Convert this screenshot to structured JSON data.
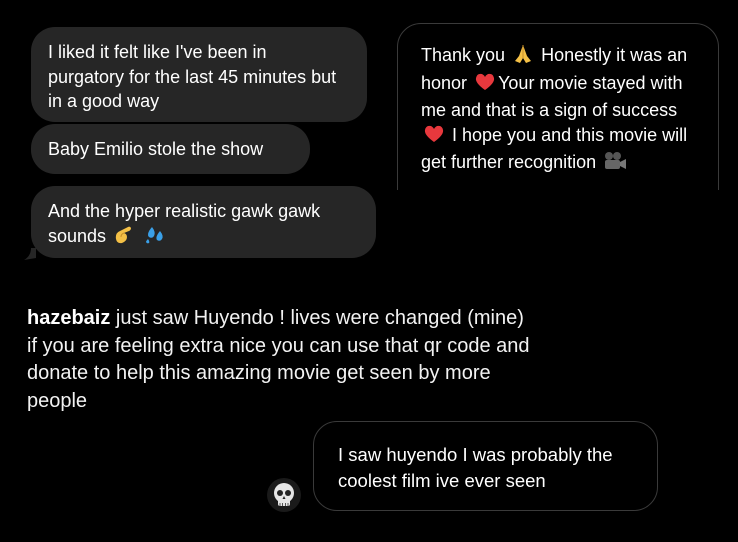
{
  "messages": {
    "m1": "I liked it felt like I've been in purgatory for the last 45 minutes but in a good way",
    "m2": "Baby Emilio stole the show",
    "m3": "And the hyper realistic gawk gawk sounds",
    "m4_part1": "Thank you",
    "m4_part2": "Honestly it was an honor",
    "m4_part3": "Your movie stayed with me and that is a sign of success",
    "m4_part4": "I hope you and this movie will get further recognition",
    "m5": "I saw huyendo I was probably the coolest film ive ever seen"
  },
  "post": {
    "username": "hazebaiz",
    "caption": "just saw Huyendo ! lives were changed (mine) if you are feeling extra nice you can use that qr code and donate to help this amazing movie get seen by more people"
  },
  "icons": {
    "pinch": "pinching-hand-icon",
    "droplets": "sweat-droplets-icon",
    "pray": "folded-hands-icon",
    "heart": "red-heart-icon",
    "camera": "movie-camera-icon",
    "avatar": "skull-avatar-icon"
  },
  "colors": {
    "background": "#000000",
    "incoming_bubble": "#262626",
    "outgoing_border": "#3a3a3a",
    "heart": "#e8383d",
    "droplets": "#3aa0e8"
  }
}
